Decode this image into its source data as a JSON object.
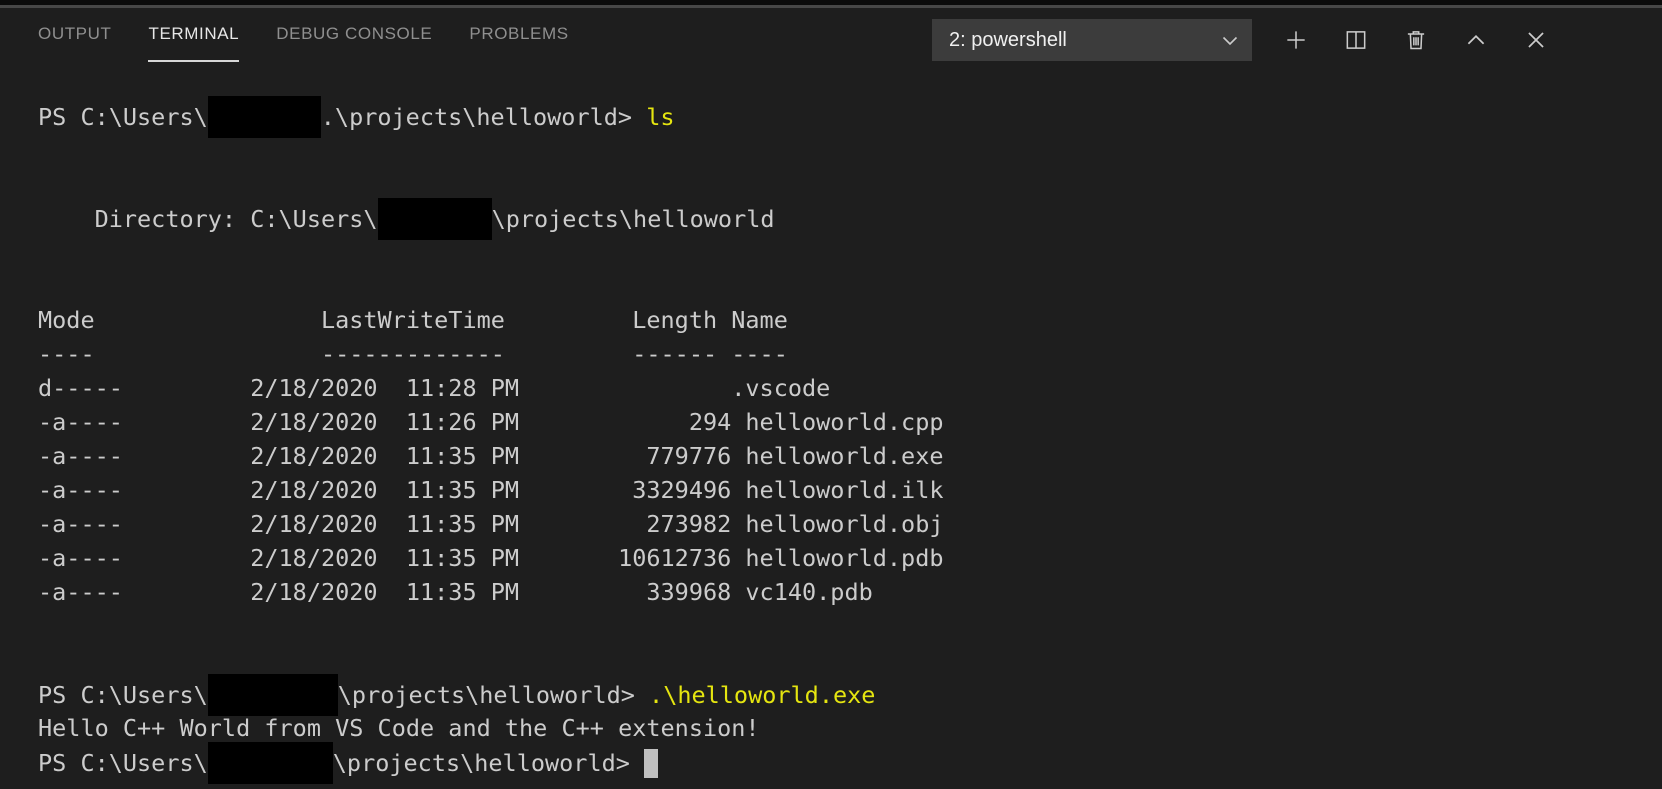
{
  "colors": {
    "panel_bg": "#1e1e1e",
    "panel_border": "#474747",
    "terminal_fg": "#cccccc",
    "command_yellow": "#e5e510",
    "tab_active": "#e7e7e7",
    "tab_inactive": "#8f8f8f",
    "tab_underline": "#d7d7d7",
    "dropdown_bg": "#3c3c3c",
    "dropdown_fg": "#f0f0f0",
    "icon_fg": "#cccccc",
    "redaction": "#000000",
    "cursor": "#c0c0c0"
  },
  "panel": {
    "tabs": [
      {
        "label": "OUTPUT",
        "active": false
      },
      {
        "label": "TERMINAL",
        "active": true
      },
      {
        "label": "DEBUG CONSOLE",
        "active": false
      },
      {
        "label": "PROBLEMS",
        "active": false
      }
    ],
    "terminal_picker": {
      "value": "2: powershell",
      "chevron": "chevron-down-icon"
    },
    "actions": [
      {
        "id": "new-terminal",
        "icon": "plus-icon"
      },
      {
        "id": "split-terminal",
        "icon": "split-icon"
      },
      {
        "id": "kill-terminal",
        "icon": "trash-icon"
      },
      {
        "id": "maximize-panel",
        "icon": "chevron-up-icon"
      },
      {
        "id": "close-panel",
        "icon": "close-icon"
      }
    ]
  },
  "terminal": {
    "lines": [
      {
        "segs": [
          {
            "t": "PS C:\\Users\\"
          },
          {
            "redact": 113
          },
          {
            "t": ".\\projects\\helloworld> "
          },
          {
            "t": "ls",
            "c": "cmd"
          }
        ]
      },
      {
        "segs": []
      },
      {
        "segs": []
      },
      {
        "segs": [
          {
            "t": "    Directory: C:\\Users\\"
          },
          {
            "redact": 114
          },
          {
            "t": "\\projects\\helloworld"
          }
        ]
      },
      {
        "segs": []
      },
      {
        "segs": []
      },
      {
        "segs": [
          {
            "t": "Mode                LastWriteTime         Length Name"
          }
        ]
      },
      {
        "segs": [
          {
            "t": "----                -------------         ------ ----"
          }
        ]
      },
      {
        "segs": [
          {
            "t": "d-----         2/18/2020  11:28 PM               .vscode"
          }
        ]
      },
      {
        "segs": [
          {
            "t": "-a----         2/18/2020  11:26 PM            294 helloworld.cpp"
          }
        ]
      },
      {
        "segs": [
          {
            "t": "-a----         2/18/2020  11:35 PM         779776 helloworld.exe"
          }
        ]
      },
      {
        "segs": [
          {
            "t": "-a----         2/18/2020  11:35 PM        3329496 helloworld.ilk"
          }
        ]
      },
      {
        "segs": [
          {
            "t": "-a----         2/18/2020  11:35 PM         273982 helloworld.obj"
          }
        ]
      },
      {
        "segs": [
          {
            "t": "-a----         2/18/2020  11:35 PM       10612736 helloworld.pdb"
          }
        ]
      },
      {
        "segs": [
          {
            "t": "-a----         2/18/2020  11:35 PM         339968 vc140.pdb"
          }
        ]
      },
      {
        "segs": []
      },
      {
        "segs": []
      },
      {
        "segs": [
          {
            "t": "PS C:\\Users\\"
          },
          {
            "redact": 130
          },
          {
            "t": "\\projects\\helloworld> "
          },
          {
            "t": ".\\helloworld.exe",
            "c": "cmd"
          }
        ]
      },
      {
        "segs": [
          {
            "t": "Hello C++ World from VS Code and the C++ extension!"
          }
        ]
      },
      {
        "segs": [
          {
            "t": "PS C:\\Users\\"
          },
          {
            "redact": 125
          },
          {
            "t": "\\projects\\helloworld> "
          },
          {
            "cursor": true
          }
        ]
      }
    ]
  }
}
